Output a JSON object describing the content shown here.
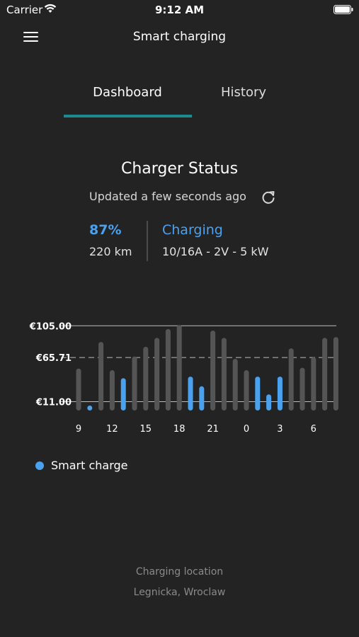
{
  "status_bar": {
    "carrier": "Carrier",
    "time": "9:12 AM"
  },
  "nav": {
    "title": "Smart charging",
    "menu_icon": "hamburger-menu-icon"
  },
  "tabs": [
    {
      "label": "Dashboard",
      "active": true
    },
    {
      "label": "History",
      "active": false
    }
  ],
  "accent_color": "#1e8a8f",
  "status": {
    "title": "Charger Status",
    "updated": "Updated a few seconds ago",
    "refresh_icon": "refresh-icon",
    "battery_percent": "87%",
    "range": "220 km",
    "charging_state": "Charging",
    "charging_detail": "10/16A - 2V - 5 kW",
    "highlight_color": "#4aa2ef"
  },
  "chart_data": {
    "type": "bar",
    "y_tick_labels": [
      "€105.00",
      "€65.71",
      "€11.00"
    ],
    "y_ticks": [
      105.0,
      65.71,
      11.0
    ],
    "x_tick_labels": [
      "9",
      "12",
      "15",
      "18",
      "21",
      "0",
      "3",
      "6"
    ],
    "categories": [
      "9",
      "10",
      "11",
      "12",
      "13",
      "14",
      "15",
      "16",
      "17",
      "18",
      "19",
      "20",
      "21",
      "22",
      "23",
      "0",
      "1",
      "2",
      "3",
      "4",
      "5",
      "6",
      "7",
      "8"
    ],
    "values": [
      52,
      5,
      85,
      50,
      40,
      67,
      79,
      90,
      101,
      106,
      42,
      30,
      99,
      90,
      64,
      50,
      42,
      20,
      42,
      77,
      53,
      66,
      90,
      91
    ],
    "smart_charge": [
      false,
      true,
      false,
      false,
      true,
      false,
      false,
      false,
      false,
      false,
      true,
      true,
      false,
      false,
      false,
      false,
      true,
      true,
      true,
      false,
      false,
      false,
      false,
      false
    ],
    "reference_line": 65.71,
    "ylim": [
      0,
      110
    ],
    "series_colors": {
      "price": "#555555",
      "smart_charge": "#4aa2ef"
    },
    "legend": [
      {
        "name": "Smart charge",
        "color": "#4aa2ef"
      }
    ]
  },
  "location": {
    "label": "Charging location",
    "value": "Legnicka, Wroclaw"
  }
}
